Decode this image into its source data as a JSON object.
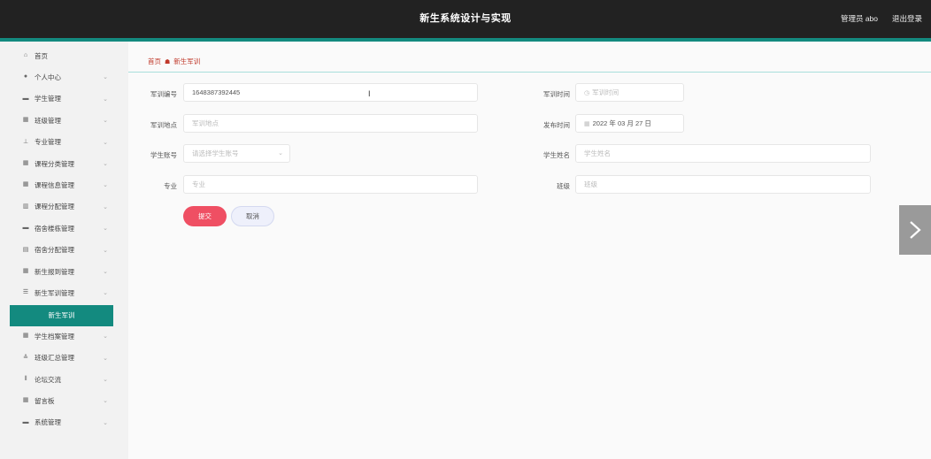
{
  "header": {
    "title": "新生系统设计与实现",
    "user": "管理员 abo",
    "logout": "退出登录"
  },
  "sidebar": {
    "items": [
      {
        "label": "首页",
        "icon": "home-icon",
        "glyph": "⌂"
      },
      {
        "label": "个人中心",
        "icon": "user-icon",
        "glyph": "●"
      },
      {
        "label": "学生管理",
        "icon": "student-icon",
        "glyph": "▬"
      },
      {
        "label": "班级管理",
        "icon": "grid-icon",
        "glyph": "▦"
      },
      {
        "label": "专业管理",
        "icon": "major-icon",
        "glyph": "⊥"
      },
      {
        "label": "课程分类管理",
        "icon": "category-icon",
        "glyph": "▦"
      },
      {
        "label": "课程信息管理",
        "icon": "grid-icon",
        "glyph": "▦"
      },
      {
        "label": "课程分配管理",
        "icon": "chart-icon",
        "glyph": "▥"
      },
      {
        "label": "宿舍楼栋管理",
        "icon": "building-icon",
        "glyph": "▬"
      },
      {
        "label": "宿舍分配管理",
        "icon": "doc-icon",
        "glyph": "▤"
      },
      {
        "label": "新生报到管理",
        "icon": "grid-icon",
        "glyph": "▦"
      },
      {
        "label": "新生军训管理",
        "icon": "list-icon",
        "glyph": "☰"
      }
    ],
    "active_sub": "新生军训",
    "items_after": [
      {
        "label": "学生档案管理",
        "icon": "grid-icon",
        "glyph": "▦"
      },
      {
        "label": "班级汇总管理",
        "icon": "stack-icon",
        "glyph": "≙"
      },
      {
        "label": "论坛交流",
        "icon": "forum-icon",
        "glyph": "⦀"
      },
      {
        "label": "留言板",
        "icon": "grid-icon",
        "glyph": "▦"
      },
      {
        "label": "系统管理",
        "icon": "system-icon",
        "glyph": "▬"
      }
    ]
  },
  "breadcrumb": {
    "home": "首页",
    "current": "新生军训"
  },
  "form": {
    "id_label": "军训编号",
    "id_value": "1648387392445",
    "time_label": "军训时间",
    "time_placeholder": "军训时间",
    "place_label": "军训地点",
    "place_placeholder": "军训地点",
    "publish_label": "发布时间",
    "publish_value": "2022 年 03 月 27 日",
    "account_label": "学生账号",
    "account_placeholder": "请选择学生账号",
    "name_label": "学生姓名",
    "name_placeholder": "学生姓名",
    "major_label": "专业",
    "major_placeholder": "专业",
    "class_label": "班级",
    "class_placeholder": "班级",
    "submit": "提交",
    "cancel": "取消"
  },
  "colors": {
    "topbar": "#222222",
    "accent": "#138a7f",
    "submit": "#ef4f63"
  }
}
